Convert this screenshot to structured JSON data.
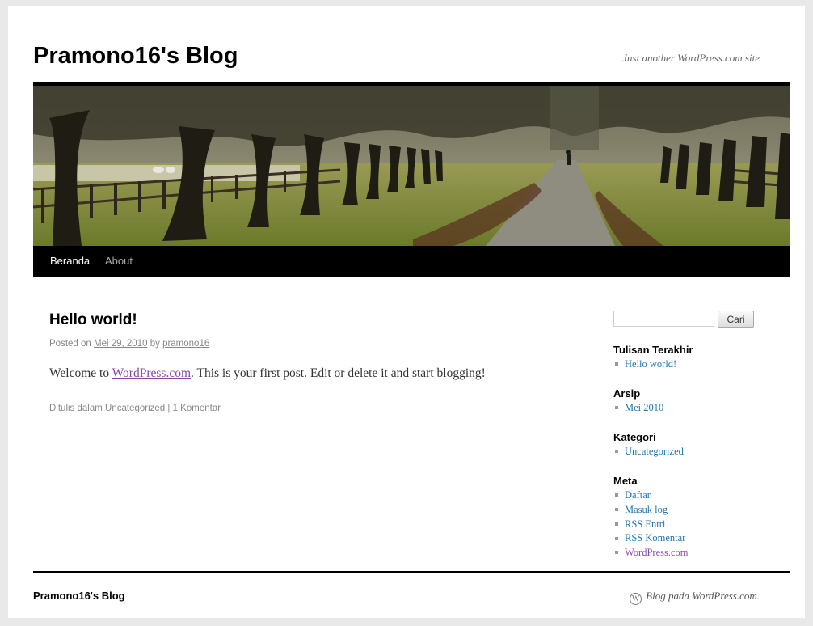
{
  "site": {
    "title": "Pramono16's Blog",
    "description": "Just another WordPress.com site"
  },
  "nav": [
    {
      "label": "Beranda",
      "current": true
    },
    {
      "label": "About",
      "current": false
    }
  ],
  "post": {
    "title": "Hello world!",
    "meta": {
      "posted_on": "Posted on",
      "date": "Mei 29, 2010",
      "by": "by",
      "author": "pramono16"
    },
    "content": {
      "before": "Welcome to ",
      "link": "WordPress.com",
      "after": ". This is your first post. Edit or delete it and start blogging!"
    },
    "footer": {
      "filed_in": "Ditulis dalam",
      "category": "Uncategorized",
      "separator": "|",
      "comments": "1 Komentar"
    }
  },
  "sidebar": {
    "search": {
      "value": "",
      "button": "Cari"
    },
    "widgets": [
      {
        "title": "Tulisan Terakhir",
        "items": [
          "Hello world!"
        ]
      },
      {
        "title": "Arsip",
        "items": [
          "Mei 2010"
        ]
      },
      {
        "title": "Kategori",
        "items": [
          "Uncategorized"
        ]
      },
      {
        "title": "Meta",
        "items": [
          "Daftar",
          "Masuk log",
          "RSS Entri",
          "RSS Komentar",
          "WordPress.com"
        ]
      }
    ]
  },
  "footer": {
    "title": "Pramono16's Blog",
    "credit": "Blog pada WordPress.com.",
    "logo_icon": "wordpress-logo-icon"
  },
  "colors": {
    "link": "#2278b0",
    "visited_link": "#7f4aa0",
    "nav_background": "#000000"
  }
}
